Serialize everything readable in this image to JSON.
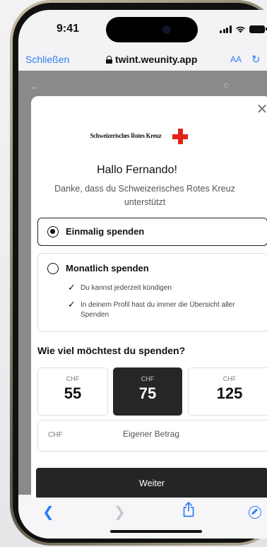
{
  "status_bar": {
    "time": "9:41"
  },
  "browser": {
    "close_label": "Schließen",
    "url": "twint.weunity.app",
    "text_size_label": "AA",
    "reload_icon": "reload-icon"
  },
  "modal": {
    "close_icon": "close-icon",
    "org_name": "Schweizerisches Rotes Kreuz",
    "greeting": "Hallo Fernando!",
    "thanks": "Danke, dass du Schweizerisches Rotes Kreuz unterstützt",
    "options": [
      {
        "label": "Einmalig spenden",
        "selected": true
      },
      {
        "label": "Monatlich spenden",
        "selected": false,
        "benefits": [
          "Du kannst jederzeit kündigen",
          "In deinem Profil hast du immer die Übersicht aller Spenden"
        ]
      }
    ],
    "question": "Wie viel möchtest du spenden?",
    "amounts": [
      {
        "currency": "CHF",
        "value": "55",
        "selected": false
      },
      {
        "currency": "CHF",
        "value": "75",
        "selected": true
      },
      {
        "currency": "CHF",
        "value": "125",
        "selected": false
      }
    ],
    "custom": {
      "currency": "CHF",
      "placeholder": "Eigener Betrag",
      "value": ""
    },
    "continue_label": "Weiter"
  },
  "toolbar": {
    "back_icon": "back-arrow-icon",
    "forward_icon": "forward-arrow-icon",
    "share_icon": "share-icon",
    "compass_icon": "compass-icon"
  },
  "colors": {
    "accent": "#2f7cf6",
    "brand_red": "#e2231a",
    "dark": "#252525"
  }
}
